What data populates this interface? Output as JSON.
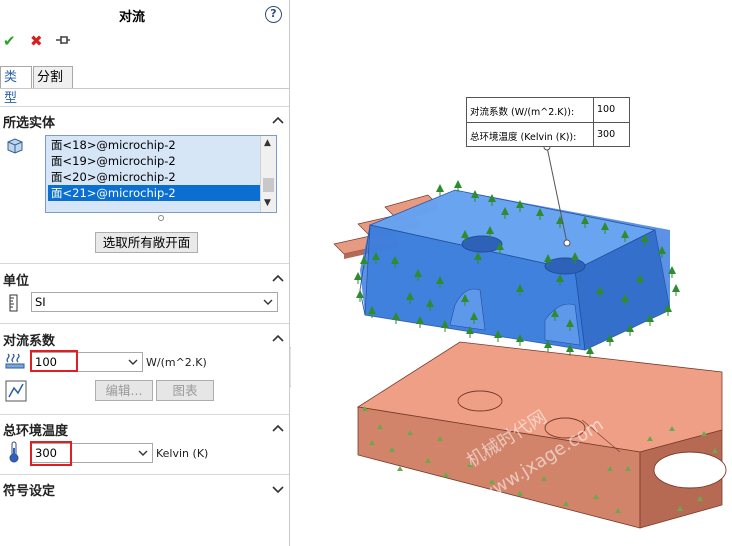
{
  "header": {
    "title": "对流"
  },
  "tabs": [
    "类型",
    "分割"
  ],
  "sections": {
    "selected_entities": {
      "title": "所选实体",
      "items": [
        "面<18>@microchip-2",
        "面<19>@microchip-2",
        "面<20>@microchip-2",
        "面<21>@microchip-2"
      ],
      "selected_index": 3,
      "select_open_faces_label": "选取所有敞开面"
    },
    "units": {
      "title": "单位",
      "value": "SI"
    },
    "convection_coefficient": {
      "title": "对流系数",
      "value": "100",
      "unit": "W/(m^2.K)",
      "edit_label": "编辑...",
      "chart_label": "图表"
    },
    "ambient_temperature": {
      "title": "总环境温度",
      "value": "300",
      "unit": "Kelvin (K)"
    },
    "symbol_settings": {
      "title": "符号设定"
    }
  },
  "callout": {
    "rows": [
      {
        "label": "对流系数 (W/(m^2.K)):",
        "value": "100"
      },
      {
        "label": "总环境温度 (Kelvin (K)):",
        "value": "300"
      }
    ]
  },
  "watermark": {
    "line1": "机械时代网",
    "line2": "www.jxage.com"
  },
  "colors": {
    "selection_blue": "#0a6fd0",
    "part_blue": "#4f8fe6",
    "plate_salmon": "#e9967a",
    "convection_arrow_green": "#2e8b2e",
    "highlight_red": "#e02020"
  },
  "icons": [
    "help-icon",
    "ok-check-icon",
    "cancel-x-icon",
    "pushpin-icon",
    "solid-body-icon",
    "ruler-icon",
    "convection-coefficient-icon",
    "chart-icon",
    "thermometer-icon"
  ]
}
